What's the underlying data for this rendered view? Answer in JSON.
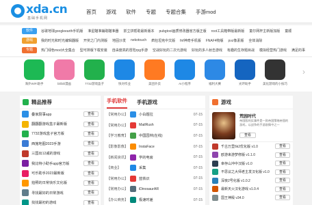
{
  "header": {
    "logo_text": "xda.cn",
    "logo_sub": "基础手机网",
    "nav": [
      "首页",
      "游戏",
      "软件",
      "专题",
      "专题合集",
      "手游mod"
    ]
  },
  "tag_rows": [
    {
      "badge": "软件",
      "color": "#3aa0f0",
      "links": [
        "谷歌地球googleearth手机版",
        "准星瞄准辅助瞄准器",
        "抓立拼帮助最新版本",
        "pubgtool画质修改器官方版正版",
        "root工具箱带版最新版",
        "童尔网杯主新版加版",
        "童顺"
      ]
    },
    {
      "badge": "游戏",
      "color": "#f0a030",
      "links": [
        "我的时光和时光编辑器版",
        "开奖之门内测版",
        "地固沙发",
        "nekotouch",
        "疯狂坦克中文版",
        "fnf神奇手机版",
        "FNAF4物版",
        "pvz像素版",
        "全体消除"
      ]
    },
    {
      "badge": "专题",
      "color": "#f07030",
      "links": [
        "热门绿色mod大全集合",
        "型可排版下载安装",
        "自由度高的冒险rpg手游",
        "空战好玩的二次元游戏",
        "好玩的多人射击游戏",
        "有趣的生存题目战",
        "模拟经营热门游戏",
        "满足的事"
      ]
    }
  ],
  "apps": [
    {
      "name": "海外WiFi助手",
      "color": "#1db954"
    },
    {
      "name": "bilibili漫画",
      "color": "#f07aa8"
    },
    {
      "name": "7732游戏盒子",
      "color": "#22b14c"
    },
    {
      "name": "快对作业",
      "color": "#1e88e5"
    },
    {
      "name": "美团外卖",
      "color": "#ff7a22"
    },
    {
      "name": "AI小程序",
      "color": "#1e88e5"
    },
    {
      "name": "福利大赛",
      "color": "#2d89e5"
    },
    {
      "name": "光环助手",
      "color": "#1565c0"
    },
    {
      "name": "美化游戏的小技巧",
      "color": "#333333"
    }
  ],
  "left_panel": {
    "title": "精品推荐",
    "button_label": "查看",
    "items": [
      {
        "name": "叠家厨事app",
        "color": "#2b8fe6"
      },
      {
        "name": "翻翻翻游戏盒子最新版",
        "color": "#f4b400"
      },
      {
        "name": "7732游戏盒子官方版",
        "color": "#22b14c"
      },
      {
        "name": "西施地图2023手游",
        "color": "#3a7bd5"
      },
      {
        "name": "三国出12戚的游戏",
        "color": "#c0392b"
      },
      {
        "name": "我比特小助手app官方版",
        "color": "#7b1fa2"
      },
      {
        "name": "可乐助手2023最新版",
        "color": "#e91e63"
      },
      {
        "name": "拍照的日常快乐文化版",
        "color": "#ff9800"
      },
      {
        "name": "寻找最好的日常游戏",
        "color": "#607d8b"
      },
      {
        "name": "找找最初的游戏",
        "color": "#009688"
      }
    ]
  },
  "mid_panel": {
    "tabs": [
      "手机软件",
      "手机游戏"
    ],
    "rows": [
      {
        "cat": "【常用办公】",
        "name": "小白题拉",
        "date": "07-15",
        "color": "#2b8fe6"
      },
      {
        "cat": "【常用办公】",
        "name": "MailRush",
        "date": "07-15",
        "color": "#e53935"
      },
      {
        "cat": "【学习教育】",
        "name": "中国园林(在线)",
        "date": "07-15",
        "color": "#43a047"
      },
      {
        "cat": "【影像影像】",
        "name": "InstaFace",
        "date": "07-15",
        "color": "#fb8c00"
      },
      {
        "cat": "【新闻资讯】",
        "name": "学的电房",
        "date": "07-15",
        "color": "#8e24aa"
      },
      {
        "cat": "【商业】",
        "name": "采集",
        "date": "07-15",
        "color": "#1e88e5"
      },
      {
        "cat": "【常用办公】",
        "name": "蓝铁识",
        "date": "07-15",
        "color": "#e53935"
      },
      {
        "cat": "【常用办公】",
        "name": "iDinosaurAR",
        "date": "07-15",
        "color": "#546e7a"
      },
      {
        "cat": "【办公商务】",
        "name": "极速时差",
        "date": "07-15",
        "color": "#00897b"
      }
    ]
  },
  "right_panel": {
    "title": "游戏",
    "feature_title": "荒园时代",
    "feature_desc": "帝国版的实事件是一款帝国策略帝国的游戏，以战争的手游剧情中之一",
    "feature_button": "查看",
    "button_label": "查看",
    "items": [
      {
        "name": "千古万里6k2优化版 v1.0",
        "color": "#c0392b"
      },
      {
        "name": "欧游来游梦修版 v1.1.0",
        "color": "#8e44ad"
      },
      {
        "name": "幸存山冲中汉版 v1.0",
        "color": "#2c3e50"
      },
      {
        "name": "不思议之大师老主发汉化版 v1.0",
        "color": "#16a085"
      },
      {
        "name": "深夜2号化版 v1.0.2",
        "color": "#2980b9"
      },
      {
        "name": "最新天火汉化游戏 v1.0.4",
        "color": "#d35400"
      },
      {
        "name": "国王神殿 v34.0",
        "color": "#7f8c8d"
      }
    ]
  }
}
